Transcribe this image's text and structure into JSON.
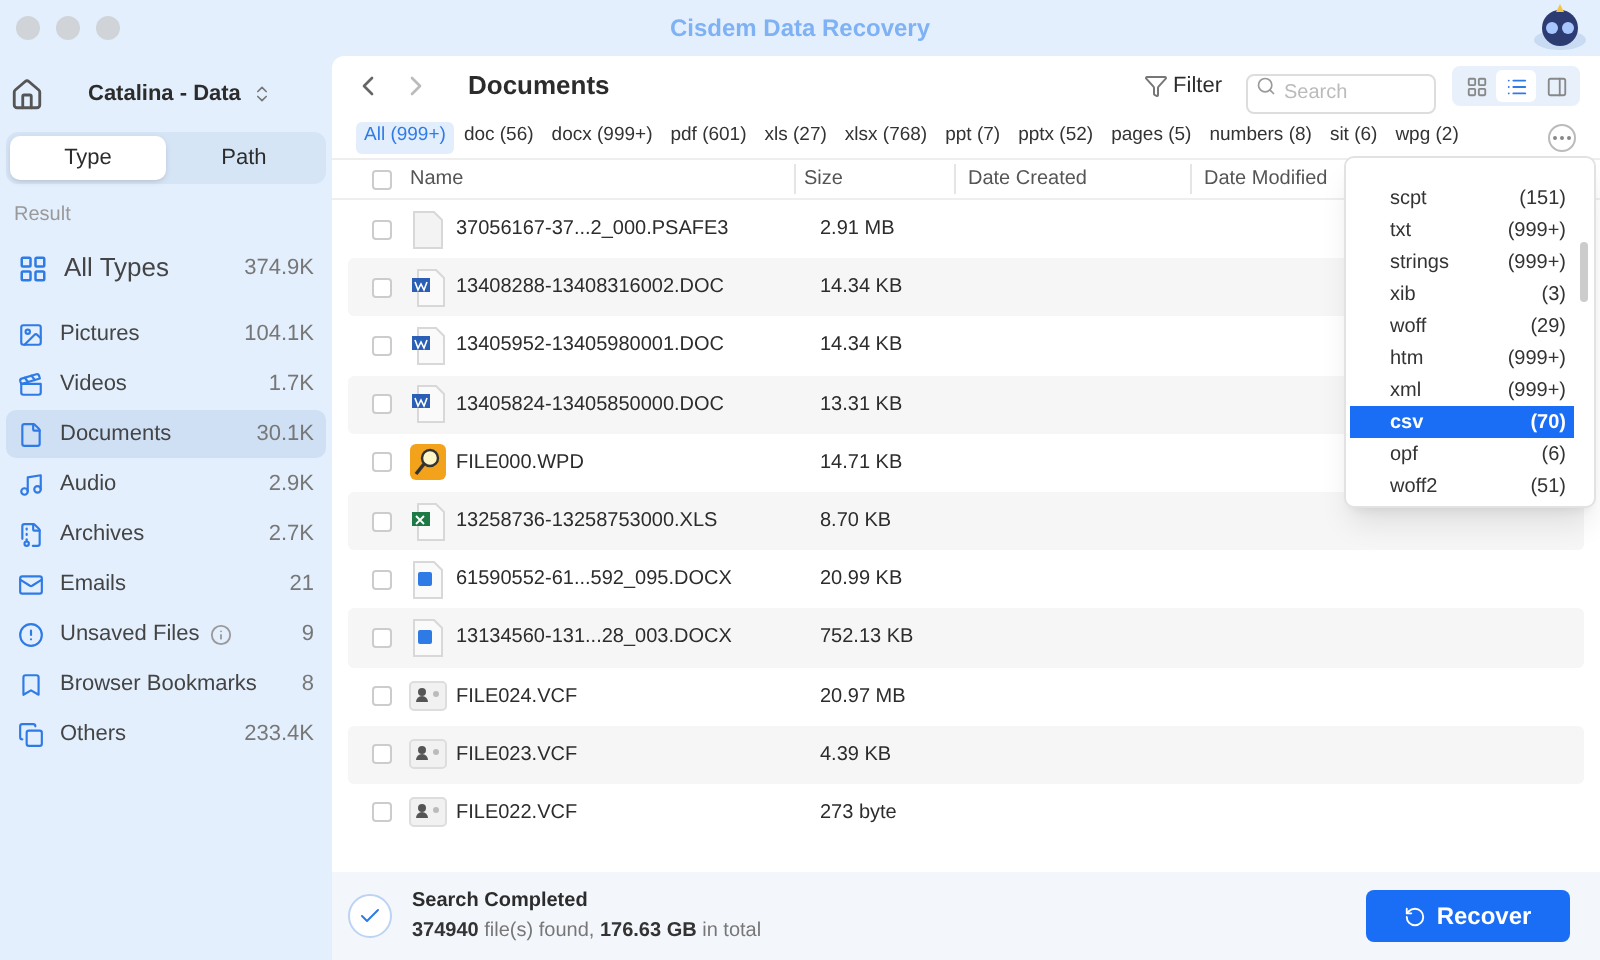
{
  "window": {
    "title": "Cisdem Data Recovery"
  },
  "sidebar": {
    "drive": "Catalina - Data",
    "tabs": [
      {
        "label": "Type",
        "selected": true
      },
      {
        "label": "Path",
        "selected": false
      }
    ],
    "section": "Result",
    "items": [
      {
        "label": "All Types",
        "count": "374.9K",
        "selected": false,
        "info": false
      },
      {
        "label": "Pictures",
        "count": "104.1K",
        "selected": false,
        "info": false
      },
      {
        "label": "Videos",
        "count": "1.7K",
        "selected": false,
        "info": false
      },
      {
        "label": "Documents",
        "count": "30.1K",
        "selected": true,
        "info": false
      },
      {
        "label": "Audio",
        "count": "2.9K",
        "selected": false,
        "info": false
      },
      {
        "label": "Archives",
        "count": "2.7K",
        "selected": false,
        "info": false
      },
      {
        "label": "Emails",
        "count": "21",
        "selected": false,
        "info": false
      },
      {
        "label": "Unsaved Files",
        "count": "9",
        "selected": false,
        "info": true
      },
      {
        "label": "Browser Bookmarks",
        "count": "8",
        "selected": false,
        "info": false
      },
      {
        "label": "Others",
        "count": "233.4K",
        "selected": false,
        "info": false
      }
    ]
  },
  "toolbar": {
    "title": "Documents",
    "filter": "Filter",
    "search": {
      "placeholder": "Search"
    },
    "views": [
      {
        "selected": false
      },
      {
        "selected": true
      },
      {
        "selected": false
      }
    ]
  },
  "chips": [
    {
      "label": "All (999+)",
      "selected": true
    },
    {
      "label": "doc (56)",
      "selected": false
    },
    {
      "label": "docx (999+)",
      "selected": false
    },
    {
      "label": "pdf (601)",
      "selected": false
    },
    {
      "label": "xls (27)",
      "selected": false
    },
    {
      "label": "xlsx (768)",
      "selected": false
    },
    {
      "label": "ppt (7)",
      "selected": false
    },
    {
      "label": "pptx (52)",
      "selected": false
    },
    {
      "label": "pages (5)",
      "selected": false
    },
    {
      "label": "numbers (8)",
      "selected": false
    },
    {
      "label": "sit (6)",
      "selected": false
    },
    {
      "label": "wpg (2)",
      "selected": false
    }
  ],
  "table": {
    "select_all": {
      "checked": false
    },
    "columns": [
      "Name",
      "Size",
      "Date Created",
      "Date Modified"
    ],
    "rows": [
      {
        "name": "37056167-37...2_000.PSAFE3",
        "size": "2.91 MB",
        "kind": "blank",
        "checked": false
      },
      {
        "name": "13408288-13408316002.DOC",
        "size": "14.34 KB",
        "kind": "doc",
        "checked": false
      },
      {
        "name": "13405952-13405980001.DOC",
        "size": "14.34 KB",
        "kind": "doc",
        "checked": false
      },
      {
        "name": "13405824-13405850000.DOC",
        "size": "13.31 KB",
        "kind": "doc",
        "checked": false
      },
      {
        "name": "FILE000.WPD",
        "size": "14.71 KB",
        "kind": "wpd",
        "checked": false
      },
      {
        "name": "13258736-13258753000.XLS",
        "size": "8.70 KB",
        "kind": "xls",
        "checked": false
      },
      {
        "name": "61590552-61...592_095.DOCX",
        "size": "20.99 KB",
        "kind": "docx",
        "checked": false
      },
      {
        "name": "13134560-131...28_003.DOCX",
        "size": "752.13 KB",
        "kind": "docx",
        "checked": false
      },
      {
        "name": "FILE024.VCF",
        "size": "20.97 MB",
        "kind": "vcf",
        "checked": false
      },
      {
        "name": "FILE023.VCF",
        "size": "4.39 KB",
        "kind": "vcf",
        "checked": false
      },
      {
        "name": "FILE022.VCF",
        "size": "273 byte",
        "kind": "vcf",
        "checked": false
      }
    ]
  },
  "dropdown": [
    {
      "label": "scpt",
      "count": "(151)",
      "selected": false
    },
    {
      "label": "txt",
      "count": "(999+)",
      "selected": false
    },
    {
      "label": "strings",
      "count": "(999+)",
      "selected": false
    },
    {
      "label": "xib",
      "count": "(3)",
      "selected": false
    },
    {
      "label": "woff",
      "count": "(29)",
      "selected": false
    },
    {
      "label": "htm",
      "count": "(999+)",
      "selected": false
    },
    {
      "label": "xml",
      "count": "(999+)",
      "selected": false
    },
    {
      "label": "csv",
      "count": "(70)",
      "selected": true
    },
    {
      "label": "opf",
      "count": "(6)",
      "selected": false
    },
    {
      "label": "woff2",
      "count": "(51)",
      "selected": false
    }
  ],
  "status": {
    "title": "Search Completed",
    "summary": "**374940** file(s) found, **176.63 GB** in total",
    "button": "Recover"
  }
}
